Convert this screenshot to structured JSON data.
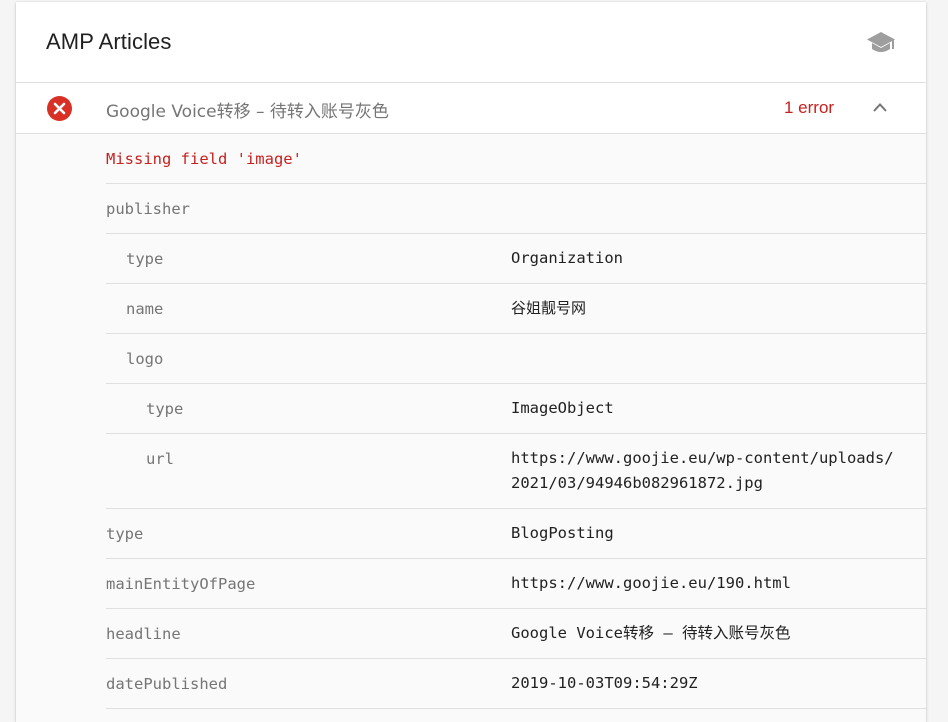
{
  "card": {
    "title": "AMP Articles",
    "learn_icon": "mortarboard-icon"
  },
  "item": {
    "name": "Google Voice转移 – 待转入账号灰色",
    "error_count": "1 error",
    "status_icon": "error-circle-icon",
    "expand_icon": "chevron-up-icon"
  },
  "details": {
    "error_message": "Missing field 'image'",
    "rows": [
      {
        "key": "publisher",
        "value": ""
      },
      {
        "key": "type",
        "value": "Organization"
      },
      {
        "key": "name",
        "value": "谷姐靓号网"
      },
      {
        "key": "logo",
        "value": ""
      },
      {
        "key": "type",
        "value": "ImageObject"
      },
      {
        "key": "url",
        "value": "https://www.goojie.eu/wp-content/uploads/2021/03/94946b082961872.jpg"
      },
      {
        "key": "type",
        "value": "BlogPosting"
      },
      {
        "key": "mainEntityOfPage",
        "value": "https://www.goojie.eu/190.html"
      },
      {
        "key": "headline",
        "value": "Google Voice转移 – 待转入账号灰色"
      },
      {
        "key": "datePublished",
        "value": "2019-10-03T09:54:29Z"
      }
    ]
  },
  "colors": {
    "error": "#c5221f",
    "error_icon_bg": "#d93025",
    "muted_text": "#757575",
    "text": "#212121",
    "divider": "#e0e0e0"
  }
}
